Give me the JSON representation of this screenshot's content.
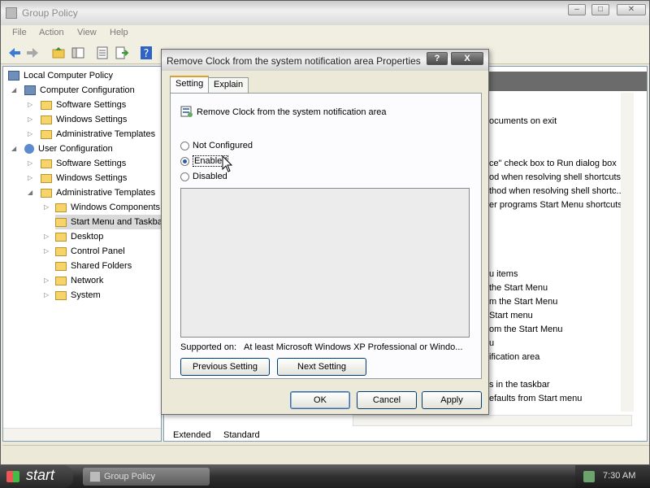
{
  "window": {
    "title": "Group Policy"
  },
  "menu": [
    "File",
    "Action",
    "View",
    "Help"
  ],
  "tree": {
    "root": "Local Computer Policy",
    "computer_config": "Computer Configuration",
    "cc_software": "Software Settings",
    "cc_windows": "Windows Settings",
    "cc_admin": "Administrative Templates",
    "user_config": "User Configuration",
    "uc_software": "Software Settings",
    "uc_windows": "Windows Settings",
    "uc_admin": "Administrative Templates",
    "windows_components": "Windows Components",
    "start_menu_taskbar": "Start Menu and Taskbar",
    "desktop": "Desktop",
    "control_panel": "Control Panel",
    "shared_folders": "Shared Folders",
    "network": "Network",
    "system": "System"
  },
  "right_list": [
    "ocuments on exit",
    "ce\" check box to Run dialog box",
    "od when resolving shell shortcuts",
    "thod when resolving shell shortc...",
    "er programs Start Menu shortcuts",
    "u items",
    "the Start Menu",
    "m the Start Menu",
    "Start menu",
    "om the Start Menu",
    "u",
    "ification area",
    "s in the taskbar",
    "efaults from Start menu"
  ],
  "view_tabs": {
    "extended": "Extended",
    "standard": "Standard"
  },
  "dialog": {
    "title": "Remove Clock from the system notification area Properties",
    "help_btn": "?",
    "close_btn": "X",
    "tab_setting": "Setting",
    "tab_explain": "Explain",
    "policy_name": "Remove Clock from the system notification area",
    "opt_not_configured": "Not Configured",
    "opt_enabled": "Enabled",
    "opt_disabled": "Disabled",
    "selected": "Enabled",
    "supported_label": "Supported on:",
    "supported_value": "At least Microsoft Windows XP Professional or Windo...",
    "prev_btn": "Previous Setting",
    "next_btn": "Next Setting",
    "ok_btn": "OK",
    "cancel_btn": "Cancel",
    "apply_btn": "Apply"
  },
  "taskbar": {
    "start": "start",
    "task": "Group Policy",
    "clock": "7:30 AM"
  }
}
